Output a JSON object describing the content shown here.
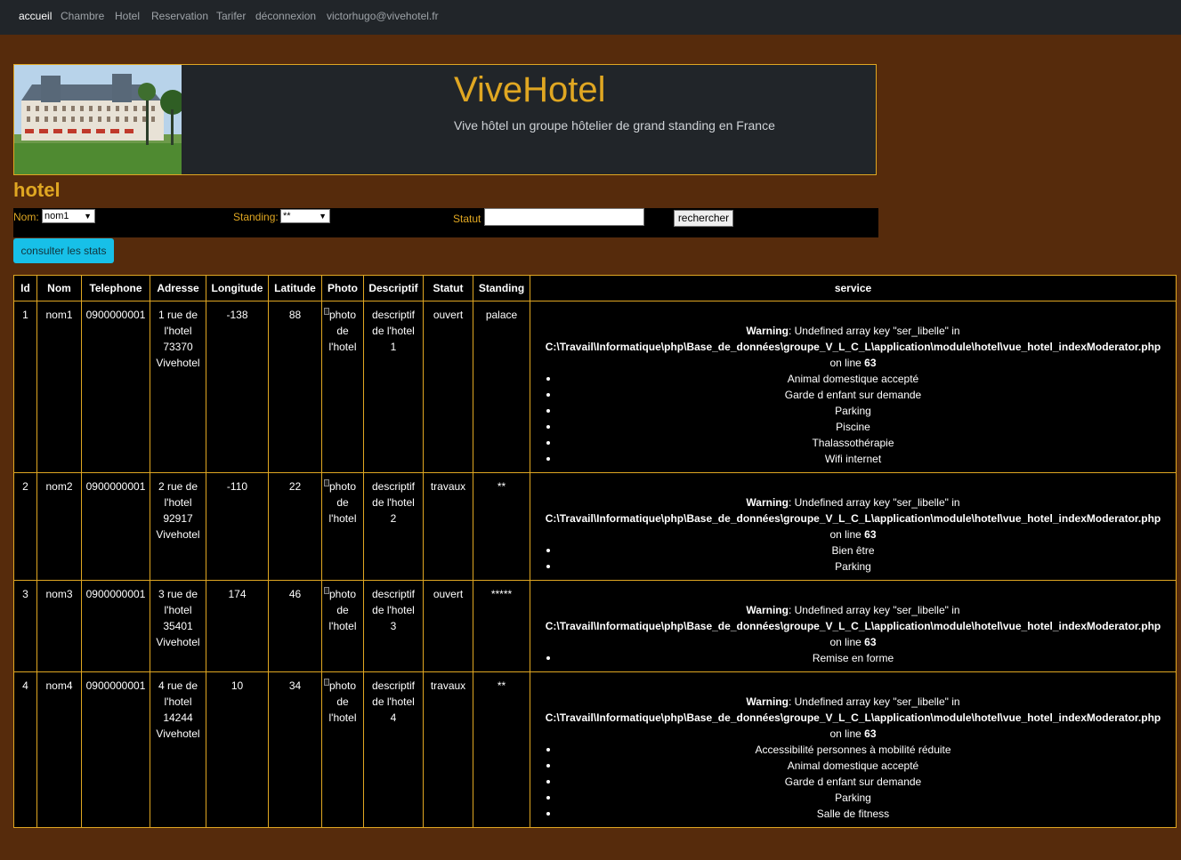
{
  "nav": {
    "items": [
      "accueil",
      "Chambre",
      "Hotel",
      "Reservation",
      "Tarifer",
      "déconnexion",
      "victorhugo@vivehotel.fr"
    ]
  },
  "banner": {
    "title": "ViveHotel",
    "subtitle": "Vive hôtel un groupe hôtelier de grand standing en France"
  },
  "page_title": "hotel",
  "filters": {
    "nom_label": "Nom:",
    "nom_value": "nom1",
    "standing_label": "Standing:",
    "standing_value": "**",
    "statut_label": "Statut",
    "statut_value": "",
    "search_button": "rechercher"
  },
  "stats_button": "consulter les stats",
  "table": {
    "headers": [
      "Id",
      "Nom",
      "Telephone",
      "Adresse",
      "Longitude",
      "Latitude",
      "Photo",
      "Descriptif",
      "Statut",
      "Standing",
      "service"
    ],
    "warning": {
      "label": "Warning",
      "message": ": Undefined array key \"ser_libelle\" in",
      "path": "C:\\Travail\\Informatique\\php\\Base_de_données\\groupe_V_L_C_L\\application\\module\\hotel\\vue_hotel_indexModerator.php",
      "on_line": "on line",
      "line": "63"
    },
    "rows": [
      {
        "id": "1",
        "nom": "nom1",
        "telephone": "0900000001",
        "adresse": [
          "1 rue de",
          "l'hotel",
          "73370",
          "Vivehotel"
        ],
        "longitude": "-138",
        "latitude": "88",
        "photo": [
          "photo",
          "de",
          "l'hotel"
        ],
        "descriptif": [
          "descriptif",
          "de l'hotel",
          "1"
        ],
        "statut": "ouvert",
        "standing": "palace",
        "services": [
          "Animal domestique accepté",
          "Garde d enfant sur demande",
          "Parking",
          "Piscine",
          "Thalassothérapie",
          "Wifi internet"
        ]
      },
      {
        "id": "2",
        "nom": "nom2",
        "telephone": "0900000001",
        "adresse": [
          "2 rue de",
          "l'hotel",
          "92917",
          "Vivehotel"
        ],
        "longitude": "-110",
        "latitude": "22",
        "photo": [
          "photo",
          "de",
          "l'hotel"
        ],
        "descriptif": [
          "descriptif",
          "de l'hotel",
          "2"
        ],
        "statut": "travaux",
        "standing": "**",
        "services": [
          "Bien être",
          "Parking"
        ]
      },
      {
        "id": "3",
        "nom": "nom3",
        "telephone": "0900000001",
        "adresse": [
          "3 rue de",
          "l'hotel",
          "35401",
          "Vivehotel"
        ],
        "longitude": "174",
        "latitude": "46",
        "photo": [
          "photo",
          "de",
          "l'hotel"
        ],
        "descriptif": [
          "descriptif",
          "de l'hotel",
          "3"
        ],
        "statut": "ouvert",
        "standing": "*****",
        "services": [
          "Remise en forme"
        ]
      },
      {
        "id": "4",
        "nom": "nom4",
        "telephone": "0900000001",
        "adresse": [
          "4 rue de",
          "l'hotel",
          "14244",
          "Vivehotel"
        ],
        "longitude": "10",
        "latitude": "34",
        "photo": [
          "photo",
          "de",
          "l'hotel"
        ],
        "descriptif": [
          "descriptif",
          "de l'hotel",
          "4"
        ],
        "statut": "travaux",
        "standing": "**",
        "services": [
          "Accessibilité personnes à mobilité réduite",
          "Animal domestique accepté",
          "Garde d enfant sur demande",
          "Parking",
          "Salle de fitness"
        ]
      }
    ]
  },
  "colors": {
    "page_bg": "#562b0c",
    "navbar_bg": "#212529",
    "accent": "#e0a722",
    "stats_button_bg": "#17c0e8"
  }
}
